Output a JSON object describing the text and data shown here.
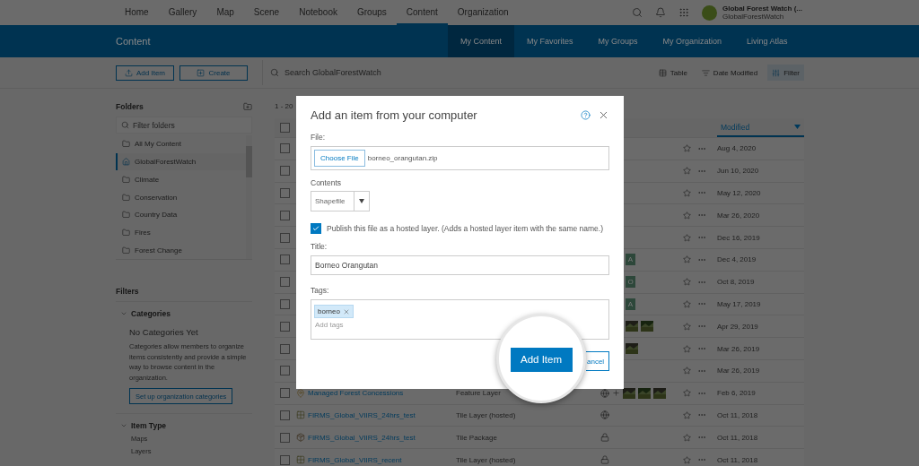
{
  "top_nav": {
    "items": [
      {
        "label": "Home",
        "selected": false
      },
      {
        "label": "Gallery",
        "selected": false
      },
      {
        "label": "Map",
        "selected": false
      },
      {
        "label": "Scene",
        "selected": false
      },
      {
        "label": "Notebook",
        "selected": false
      },
      {
        "label": "Groups",
        "selected": false
      },
      {
        "label": "Content",
        "selected": true
      },
      {
        "label": "Organization",
        "selected": false
      }
    ],
    "account": {
      "name": "Global Forest Watch (...",
      "username": "GlobalForestWatch"
    }
  },
  "header": {
    "title": "Content",
    "tabs": [
      {
        "label": "My Content",
        "selected": true
      },
      {
        "label": "My Favorites",
        "selected": false
      },
      {
        "label": "My Groups",
        "selected": false
      },
      {
        "label": "My Organization",
        "selected": false
      },
      {
        "label": "Living Atlas",
        "selected": false
      }
    ]
  },
  "toolbar": {
    "buttons": [
      {
        "label": "Add Item",
        "kind": "upload"
      },
      {
        "label": "Create",
        "kind": "plus"
      }
    ],
    "search": {
      "placeholder": "Search GlobalForestWatch"
    },
    "view_options": [
      {
        "label": "Table",
        "kind": "table",
        "selected": false
      },
      {
        "label": "Date Modified",
        "kind": "sort",
        "selected": false
      },
      {
        "label": "Filter",
        "kind": "filter",
        "selected": true
      }
    ]
  },
  "sidebar": {
    "folders_title": "Folders",
    "folder_filter": {
      "placeholder": "Filter folders"
    },
    "folders": [
      {
        "label": "All My Content",
        "kind": "folder",
        "selected": false
      },
      {
        "label": "GlobalForestWatch",
        "kind": "home",
        "selected": true
      },
      {
        "label": "Climate",
        "kind": "folder",
        "selected": false
      },
      {
        "label": "Conservation",
        "kind": "folder",
        "selected": false
      },
      {
        "label": "Country Data",
        "kind": "folder",
        "selected": false
      },
      {
        "label": "Fires",
        "kind": "folder",
        "selected": false
      },
      {
        "label": "Forest Change",
        "kind": "folder",
        "selected": false
      }
    ],
    "filters_title": "Filters",
    "categories": {
      "title": "Categories",
      "expanded": true,
      "empty_title": "No Categories Yet",
      "description": "Categories allow members to organize items consistently and provide a simple way to browse content in the organization.",
      "button": "Set up organization categories"
    },
    "item_type": {
      "title": "Item Type",
      "expanded": true,
      "options": [
        "Maps",
        "Layers"
      ]
    }
  },
  "content": {
    "range": "1 - 20",
    "select_all": {
      "checked": false
    },
    "sort_column": "Modified",
    "rows": [
      {
        "checked": false,
        "modified": "Aug 4, 2020"
      },
      {
        "checked": false,
        "modified": "Jun 10, 2020"
      },
      {
        "checked": false,
        "modified": "May 12, 2020"
      },
      {
        "checked": false,
        "modified": "Mar 26, 2020"
      },
      {
        "checked": false,
        "modified": "Dec 16, 2019"
      },
      {
        "checked": false,
        "badge": "A",
        "modified": "Dec 4, 2019"
      },
      {
        "checked": false,
        "badge": "O",
        "modified": "Oct 8, 2019"
      },
      {
        "checked": false,
        "badge": "A",
        "modified": "May 17, 2019"
      },
      {
        "checked": false,
        "shared": [
          {
            "kind": "picture"
          },
          {
            "kind": "picture"
          }
        ],
        "modified": "Apr 29, 2019"
      },
      {
        "checked": false,
        "shared": [
          {
            "kind": "picture"
          }
        ],
        "modified": "Mar 26, 2019"
      },
      {
        "checked": false,
        "modified": "Mar 26, 2019"
      },
      {
        "checked": false,
        "kind": "feature_layer",
        "title": "Managed Forest Concessions",
        "type": "Feature Layer",
        "shared": [
          {
            "kind": "globe"
          },
          {
            "kind": "plus"
          },
          {
            "kind": "picture"
          },
          {
            "kind": "picture"
          },
          {
            "kind": "picture"
          }
        ],
        "modified": "Feb 6, 2019"
      },
      {
        "checked": false,
        "kind": "tile_layer",
        "title": "FIRMS_Global_VIIRS_24hrs_test",
        "type": "Tile Layer (hosted)",
        "shared": [
          {
            "kind": "globe"
          }
        ],
        "modified": "Oct 11, 2018"
      },
      {
        "checked": false,
        "kind": "tile_package",
        "title": "FIRMS_Global_VIIRS_24hrs_test",
        "type": "Tile Package",
        "shared": [
          {
            "kind": "lock"
          }
        ],
        "modified": "Oct 11, 2018"
      },
      {
        "checked": false,
        "kind": "tile_layer",
        "title": "FIRMS_Global_VIIRS_recent",
        "type": "Tile Layer (hosted)",
        "shared": [
          {
            "kind": "lock"
          }
        ],
        "modified": "Oct 11, 2018"
      }
    ]
  },
  "dialog": {
    "title": "Add an item from your computer",
    "file_label": "File:",
    "choose_button": "Choose File",
    "file_name": "borneo_orangutan.zip",
    "contents_label": "Contents",
    "contents_value": "Shapefile",
    "publish": {
      "checked": true,
      "label": "Publish this file as a hosted layer. (Adds a hosted layer item with the same name.)"
    },
    "title_label": "Title:",
    "title_value": "Borneo Orangutan",
    "tags_label": "Tags:",
    "tags": [
      "borneo"
    ],
    "tags_placeholder": "Add tags",
    "add_button": "Add Item",
    "cancel_button": "ancel"
  }
}
